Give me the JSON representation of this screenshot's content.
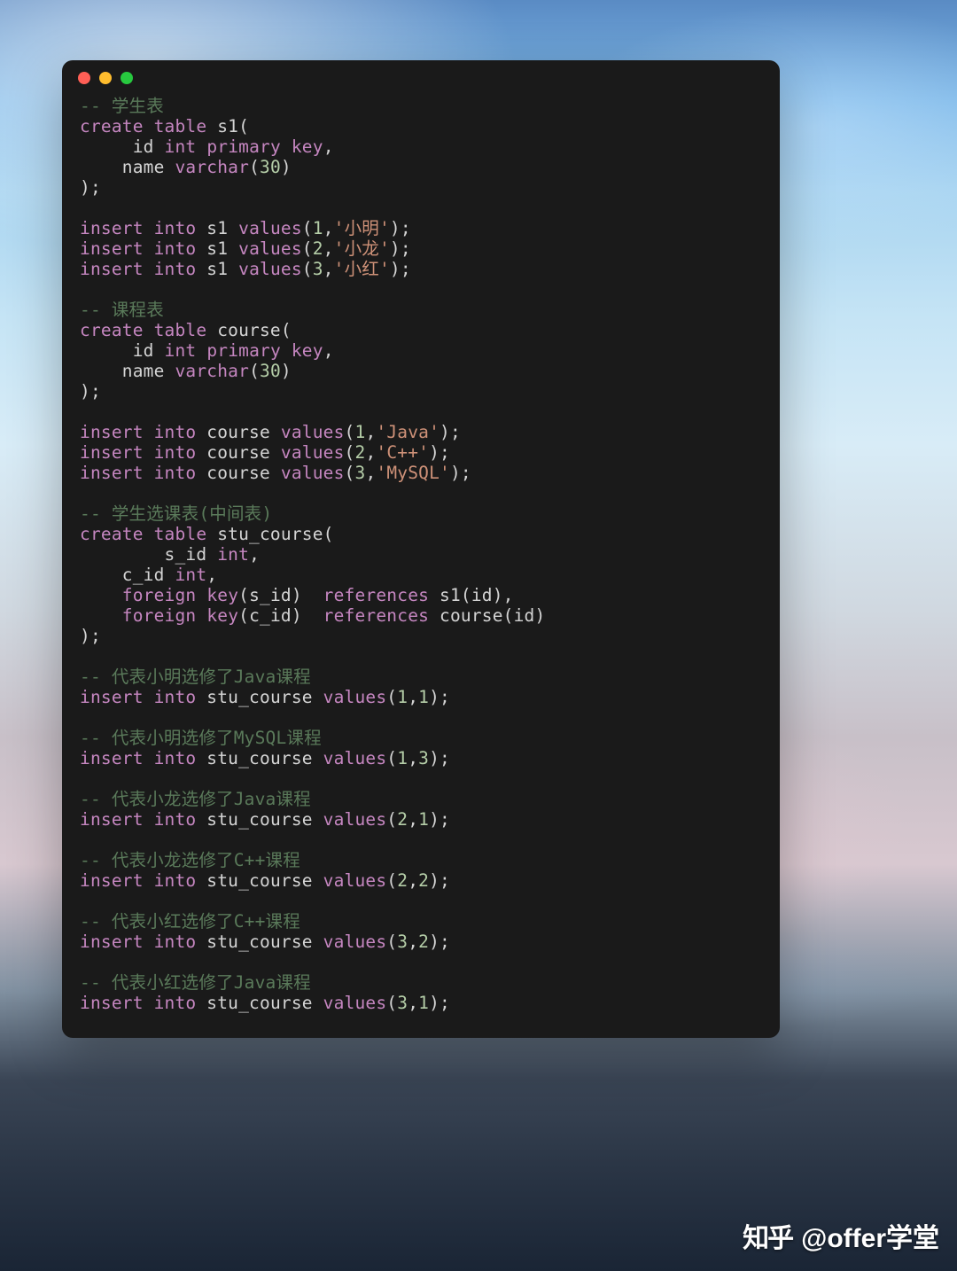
{
  "watermark": {
    "logo": "知乎",
    "handle": "@offer学堂"
  },
  "code": {
    "lines": [
      [
        {
          "c": "cmt",
          "t": "-- 学生表"
        }
      ],
      [
        {
          "c": "kw",
          "t": "create"
        },
        {
          "c": "id",
          "t": " "
        },
        {
          "c": "kw",
          "t": "table"
        },
        {
          "c": "id",
          "t": " s1("
        }
      ],
      [
        {
          "c": "id",
          "t": "     id "
        },
        {
          "c": "kw2",
          "t": "int"
        },
        {
          "c": "id",
          "t": " "
        },
        {
          "c": "kw",
          "t": "primary"
        },
        {
          "c": "id",
          "t": " "
        },
        {
          "c": "kw",
          "t": "key"
        },
        {
          "c": "id",
          "t": ","
        }
      ],
      [
        {
          "c": "id",
          "t": "    name "
        },
        {
          "c": "kw2",
          "t": "varchar"
        },
        {
          "c": "id",
          "t": "("
        },
        {
          "c": "num",
          "t": "30"
        },
        {
          "c": "id",
          "t": ")"
        }
      ],
      [
        {
          "c": "id",
          "t": ");"
        }
      ],
      [
        {
          "c": "id",
          "t": ""
        }
      ],
      [
        {
          "c": "kw",
          "t": "insert"
        },
        {
          "c": "id",
          "t": " "
        },
        {
          "c": "kw",
          "t": "into"
        },
        {
          "c": "id",
          "t": " s1 "
        },
        {
          "c": "kw",
          "t": "values"
        },
        {
          "c": "id",
          "t": "("
        },
        {
          "c": "num",
          "t": "1"
        },
        {
          "c": "id",
          "t": ","
        },
        {
          "c": "str",
          "t": "'小明'"
        },
        {
          "c": "id",
          "t": ");"
        }
      ],
      [
        {
          "c": "kw",
          "t": "insert"
        },
        {
          "c": "id",
          "t": " "
        },
        {
          "c": "kw",
          "t": "into"
        },
        {
          "c": "id",
          "t": " s1 "
        },
        {
          "c": "kw",
          "t": "values"
        },
        {
          "c": "id",
          "t": "("
        },
        {
          "c": "num",
          "t": "2"
        },
        {
          "c": "id",
          "t": ","
        },
        {
          "c": "str",
          "t": "'小龙'"
        },
        {
          "c": "id",
          "t": ");"
        }
      ],
      [
        {
          "c": "kw",
          "t": "insert"
        },
        {
          "c": "id",
          "t": " "
        },
        {
          "c": "kw",
          "t": "into"
        },
        {
          "c": "id",
          "t": " s1 "
        },
        {
          "c": "kw",
          "t": "values"
        },
        {
          "c": "id",
          "t": "("
        },
        {
          "c": "num",
          "t": "3"
        },
        {
          "c": "id",
          "t": ","
        },
        {
          "c": "str",
          "t": "'小红'"
        },
        {
          "c": "id",
          "t": ");"
        }
      ],
      [
        {
          "c": "id",
          "t": ""
        }
      ],
      [
        {
          "c": "cmt",
          "t": "-- 课程表"
        }
      ],
      [
        {
          "c": "kw",
          "t": "create"
        },
        {
          "c": "id",
          "t": " "
        },
        {
          "c": "kw",
          "t": "table"
        },
        {
          "c": "id",
          "t": " course("
        }
      ],
      [
        {
          "c": "id",
          "t": "     id "
        },
        {
          "c": "kw2",
          "t": "int"
        },
        {
          "c": "id",
          "t": " "
        },
        {
          "c": "kw",
          "t": "primary"
        },
        {
          "c": "id",
          "t": " "
        },
        {
          "c": "kw",
          "t": "key"
        },
        {
          "c": "id",
          "t": ","
        }
      ],
      [
        {
          "c": "id",
          "t": "    name "
        },
        {
          "c": "kw2",
          "t": "varchar"
        },
        {
          "c": "id",
          "t": "("
        },
        {
          "c": "num",
          "t": "30"
        },
        {
          "c": "id",
          "t": ")"
        }
      ],
      [
        {
          "c": "id",
          "t": ");"
        }
      ],
      [
        {
          "c": "id",
          "t": ""
        }
      ],
      [
        {
          "c": "kw",
          "t": "insert"
        },
        {
          "c": "id",
          "t": " "
        },
        {
          "c": "kw",
          "t": "into"
        },
        {
          "c": "id",
          "t": " course "
        },
        {
          "c": "kw",
          "t": "values"
        },
        {
          "c": "id",
          "t": "("
        },
        {
          "c": "num",
          "t": "1"
        },
        {
          "c": "id",
          "t": ","
        },
        {
          "c": "str",
          "t": "'Java'"
        },
        {
          "c": "id",
          "t": ");"
        }
      ],
      [
        {
          "c": "kw",
          "t": "insert"
        },
        {
          "c": "id",
          "t": " "
        },
        {
          "c": "kw",
          "t": "into"
        },
        {
          "c": "id",
          "t": " course "
        },
        {
          "c": "kw",
          "t": "values"
        },
        {
          "c": "id",
          "t": "("
        },
        {
          "c": "num",
          "t": "2"
        },
        {
          "c": "id",
          "t": ","
        },
        {
          "c": "str",
          "t": "'C++'"
        },
        {
          "c": "id",
          "t": ");"
        }
      ],
      [
        {
          "c": "kw",
          "t": "insert"
        },
        {
          "c": "id",
          "t": " "
        },
        {
          "c": "kw",
          "t": "into"
        },
        {
          "c": "id",
          "t": " course "
        },
        {
          "c": "kw",
          "t": "values"
        },
        {
          "c": "id",
          "t": "("
        },
        {
          "c": "num",
          "t": "3"
        },
        {
          "c": "id",
          "t": ","
        },
        {
          "c": "str",
          "t": "'MySQL'"
        },
        {
          "c": "id",
          "t": ");"
        }
      ],
      [
        {
          "c": "id",
          "t": ""
        }
      ],
      [
        {
          "c": "cmt",
          "t": "-- 学生选课表(中间表)"
        }
      ],
      [
        {
          "c": "kw",
          "t": "create"
        },
        {
          "c": "id",
          "t": " "
        },
        {
          "c": "kw",
          "t": "table"
        },
        {
          "c": "id",
          "t": " stu_course("
        }
      ],
      [
        {
          "c": "id",
          "t": "        s_id "
        },
        {
          "c": "kw2",
          "t": "int"
        },
        {
          "c": "id",
          "t": ","
        }
      ],
      [
        {
          "c": "id",
          "t": "    c_id "
        },
        {
          "c": "kw2",
          "t": "int"
        },
        {
          "c": "id",
          "t": ","
        }
      ],
      [
        {
          "c": "id",
          "t": "    "
        },
        {
          "c": "kw",
          "t": "foreign"
        },
        {
          "c": "id",
          "t": " "
        },
        {
          "c": "kw",
          "t": "key"
        },
        {
          "c": "id",
          "t": "(s_id)  "
        },
        {
          "c": "kw",
          "t": "references"
        },
        {
          "c": "id",
          "t": " s1(id),"
        }
      ],
      [
        {
          "c": "id",
          "t": "    "
        },
        {
          "c": "kw",
          "t": "foreign"
        },
        {
          "c": "id",
          "t": " "
        },
        {
          "c": "kw",
          "t": "key"
        },
        {
          "c": "id",
          "t": "(c_id)  "
        },
        {
          "c": "kw",
          "t": "references"
        },
        {
          "c": "id",
          "t": " course(id)"
        }
      ],
      [
        {
          "c": "id",
          "t": ");"
        }
      ],
      [
        {
          "c": "id",
          "t": ""
        }
      ],
      [
        {
          "c": "cmt",
          "t": "-- 代表小明选修了Java课程"
        }
      ],
      [
        {
          "c": "kw",
          "t": "insert"
        },
        {
          "c": "id",
          "t": " "
        },
        {
          "c": "kw",
          "t": "into"
        },
        {
          "c": "id",
          "t": " stu_course "
        },
        {
          "c": "kw",
          "t": "values"
        },
        {
          "c": "id",
          "t": "("
        },
        {
          "c": "num",
          "t": "1"
        },
        {
          "c": "id",
          "t": ","
        },
        {
          "c": "num",
          "t": "1"
        },
        {
          "c": "id",
          "t": ");"
        }
      ],
      [
        {
          "c": "id",
          "t": ""
        }
      ],
      [
        {
          "c": "cmt",
          "t": "-- 代表小明选修了MySQL课程"
        }
      ],
      [
        {
          "c": "kw",
          "t": "insert"
        },
        {
          "c": "id",
          "t": " "
        },
        {
          "c": "kw",
          "t": "into"
        },
        {
          "c": "id",
          "t": " stu_course "
        },
        {
          "c": "kw",
          "t": "values"
        },
        {
          "c": "id",
          "t": "("
        },
        {
          "c": "num",
          "t": "1"
        },
        {
          "c": "id",
          "t": ","
        },
        {
          "c": "num",
          "t": "3"
        },
        {
          "c": "id",
          "t": ");"
        }
      ],
      [
        {
          "c": "id",
          "t": ""
        }
      ],
      [
        {
          "c": "cmt",
          "t": "-- 代表小龙选修了Java课程"
        }
      ],
      [
        {
          "c": "kw",
          "t": "insert"
        },
        {
          "c": "id",
          "t": " "
        },
        {
          "c": "kw",
          "t": "into"
        },
        {
          "c": "id",
          "t": " stu_course "
        },
        {
          "c": "kw",
          "t": "values"
        },
        {
          "c": "id",
          "t": "("
        },
        {
          "c": "num",
          "t": "2"
        },
        {
          "c": "id",
          "t": ","
        },
        {
          "c": "num",
          "t": "1"
        },
        {
          "c": "id",
          "t": ");"
        }
      ],
      [
        {
          "c": "id",
          "t": ""
        }
      ],
      [
        {
          "c": "cmt",
          "t": "-- 代表小龙选修了C++课程"
        }
      ],
      [
        {
          "c": "kw",
          "t": "insert"
        },
        {
          "c": "id",
          "t": " "
        },
        {
          "c": "kw",
          "t": "into"
        },
        {
          "c": "id",
          "t": " stu_course "
        },
        {
          "c": "kw",
          "t": "values"
        },
        {
          "c": "id",
          "t": "("
        },
        {
          "c": "num",
          "t": "2"
        },
        {
          "c": "id",
          "t": ","
        },
        {
          "c": "num",
          "t": "2"
        },
        {
          "c": "id",
          "t": ");"
        }
      ],
      [
        {
          "c": "id",
          "t": ""
        }
      ],
      [
        {
          "c": "cmt",
          "t": "-- 代表小红选修了C++课程"
        }
      ],
      [
        {
          "c": "kw",
          "t": "insert"
        },
        {
          "c": "id",
          "t": " "
        },
        {
          "c": "kw",
          "t": "into"
        },
        {
          "c": "id",
          "t": " stu_course "
        },
        {
          "c": "kw",
          "t": "values"
        },
        {
          "c": "id",
          "t": "("
        },
        {
          "c": "num",
          "t": "3"
        },
        {
          "c": "id",
          "t": ","
        },
        {
          "c": "num",
          "t": "2"
        },
        {
          "c": "id",
          "t": ");"
        }
      ],
      [
        {
          "c": "id",
          "t": ""
        }
      ],
      [
        {
          "c": "cmt",
          "t": "-- 代表小红选修了Java课程"
        }
      ],
      [
        {
          "c": "kw",
          "t": "insert"
        },
        {
          "c": "id",
          "t": " "
        },
        {
          "c": "kw",
          "t": "into"
        },
        {
          "c": "id",
          "t": " stu_course "
        },
        {
          "c": "kw",
          "t": "values"
        },
        {
          "c": "id",
          "t": "("
        },
        {
          "c": "num",
          "t": "3"
        },
        {
          "c": "id",
          "t": ","
        },
        {
          "c": "num",
          "t": "1"
        },
        {
          "c": "id",
          "t": ");"
        }
      ]
    ]
  }
}
